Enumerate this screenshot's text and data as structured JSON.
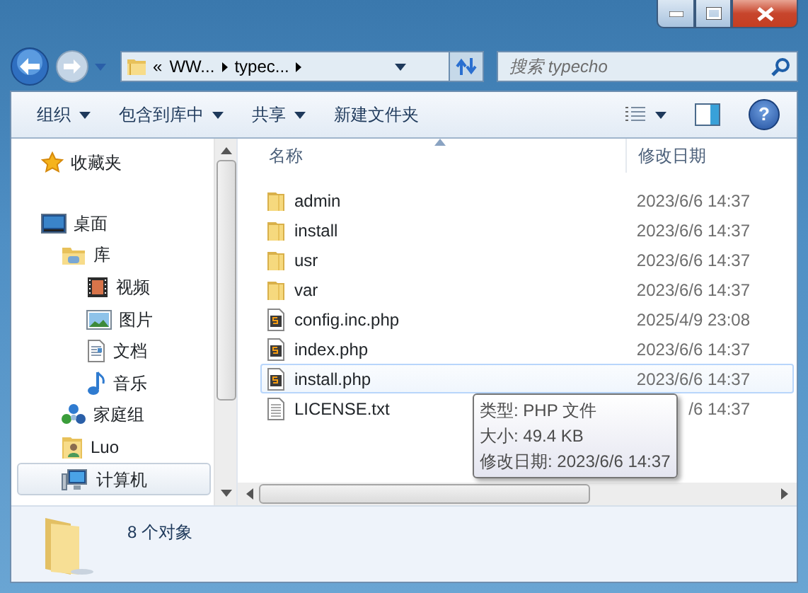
{
  "address": {
    "overflow": "«",
    "crumbs": [
      "WW...",
      "typec..."
    ]
  },
  "search": {
    "placeholder": "搜索 typecho"
  },
  "toolbar": [
    {
      "label": "组织",
      "dropdown": true
    },
    {
      "label": "包含到库中",
      "dropdown": true
    },
    {
      "label": "共享",
      "dropdown": true
    },
    {
      "label": "新建文件夹",
      "dropdown": false
    }
  ],
  "nav": [
    {
      "label": "收藏夹",
      "kind": "favorites",
      "selected": false
    },
    {
      "label": "桌面",
      "kind": "desktop",
      "selected": false,
      "children": [
        {
          "label": "库",
          "kind": "library",
          "selected": false,
          "children": [
            {
              "label": "视频",
              "kind": "video",
              "selected": false
            },
            {
              "label": "图片",
              "kind": "pictures",
              "selected": false
            },
            {
              "label": "文档",
              "kind": "documents",
              "selected": false
            },
            {
              "label": "音乐",
              "kind": "music",
              "selected": false
            }
          ]
        },
        {
          "label": "家庭组",
          "kind": "homegroup",
          "selected": false
        },
        {
          "label": "Luo",
          "kind": "user",
          "selected": false
        },
        {
          "label": "计算机",
          "kind": "computer",
          "selected": true
        }
      ]
    }
  ],
  "help": {
    "glyph": "?"
  },
  "columns": [
    {
      "label": "名称",
      "sorted": true
    },
    {
      "label": "修改日期",
      "sorted": false
    }
  ],
  "files": [
    {
      "name": "admin",
      "modified": "2023/6/6 14:37",
      "kind": "folder",
      "hovered": false
    },
    {
      "name": "install",
      "modified": "2023/6/6 14:37",
      "kind": "folder",
      "hovered": false
    },
    {
      "name": "usr",
      "modified": "2023/6/6 14:37",
      "kind": "folder",
      "hovered": false
    },
    {
      "name": "var",
      "modified": "2023/6/6 14:37",
      "kind": "folder",
      "hovered": false
    },
    {
      "name": "config.inc.php",
      "modified": "2025/4/9 23:08",
      "kind": "php",
      "hovered": false
    },
    {
      "name": "index.php",
      "modified": "2023/6/6 14:37",
      "kind": "php",
      "hovered": false
    },
    {
      "name": "install.php",
      "modified": "2023/6/6 14:37",
      "kind": "php",
      "hovered": true
    },
    {
      "name": "LICENSE.txt",
      "modified": "/6 14:37",
      "kind": "text",
      "hovered": false
    }
  ],
  "tooltip": {
    "lines": [
      "类型: PHP 文件",
      "大小: 49.4 KB",
      "修改日期: 2023/6/6 14:37"
    ]
  },
  "status": {
    "text": "8 个对象"
  }
}
